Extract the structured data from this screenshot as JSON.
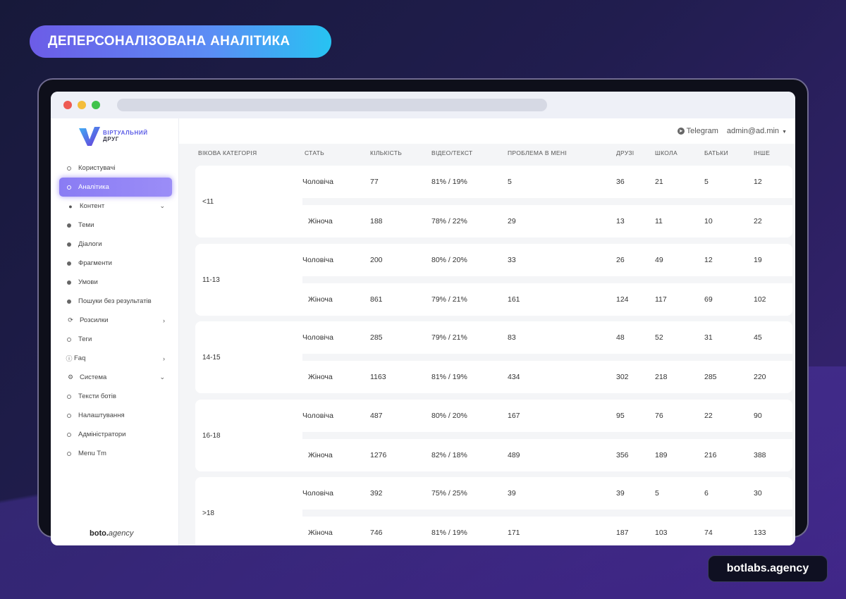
{
  "headline": "ДЕПЕРСОНАЛІЗОВАНА АНАЛІТИКА",
  "brand": "botlabs.agency",
  "logo": {
    "line1": "ВІРТУАЛЬНИЙ",
    "line2": "ДРУГ"
  },
  "topbar": {
    "telegram": "Telegram",
    "admin": "admin@ad.min"
  },
  "sidebar": {
    "items": [
      {
        "label": "Користувачі",
        "icon": "ring"
      },
      {
        "label": "Аналітика",
        "icon": "ring",
        "active": true
      },
      {
        "label": "Контент",
        "icon": "chat-icon",
        "chevron": "down"
      },
      {
        "label": "Теми",
        "icon": "dot"
      },
      {
        "label": "Діалоги",
        "icon": "dot"
      },
      {
        "label": "Фрагменти",
        "icon": "dot"
      },
      {
        "label": "Умови",
        "icon": "dot"
      },
      {
        "label": "Пошуки без результатів",
        "icon": "dot"
      },
      {
        "label": "Розсилки",
        "icon": "broadcast-icon",
        "chevron": "right"
      },
      {
        "label": "Теги",
        "icon": "ring"
      },
      {
        "label": "Faq",
        "icon": "help-icon",
        "chevron": "right"
      },
      {
        "label": "Система",
        "icon": "gears-icon",
        "chevron": "down"
      },
      {
        "label": "Тексти ботів",
        "icon": "ring"
      },
      {
        "label": "Налаштування",
        "icon": "ring"
      },
      {
        "label": "Адміністратори",
        "icon": "ring"
      },
      {
        "label": "Menu Tm",
        "icon": "ring"
      }
    ],
    "footer_bold": "boto.",
    "footer_rest": "agency"
  },
  "table": {
    "headers": [
      "Вікова категорія",
      "Стать",
      "Кількість",
      "Відео/текст",
      "Проблема в мені",
      "Друзі",
      "Школа",
      "Батьки",
      "Інше"
    ],
    "groups": [
      {
        "category": "<11",
        "rows": [
          [
            "Чоловіча",
            "77",
            "81% / 19%",
            "5",
            "36",
            "21",
            "5",
            "12"
          ],
          [
            "Жіноча",
            "188",
            "78% / 22%",
            "29",
            "13",
            "11",
            "10",
            "22"
          ]
        ]
      },
      {
        "category": "11-13",
        "rows": [
          [
            "Чоловіча",
            "200",
            "80% / 20%",
            "33",
            "26",
            "49",
            "12",
            "19"
          ],
          [
            "Жіноча",
            "861",
            "79% / 21%",
            "161",
            "124",
            "117",
            "69",
            "102"
          ]
        ]
      },
      {
        "category": "14-15",
        "rows": [
          [
            "Чоловіча",
            "285",
            "79% / 21%",
            "83",
            "48",
            "52",
            "31",
            "45"
          ],
          [
            "Жіноча",
            "1163",
            "81% / 19%",
            "434",
            "302",
            "218",
            "285",
            "220"
          ]
        ]
      },
      {
        "category": "16-18",
        "rows": [
          [
            "Чоловіча",
            "487",
            "80% / 20%",
            "167",
            "95",
            "76",
            "22",
            "90"
          ],
          [
            "Жіноча",
            "1276",
            "82% / 18%",
            "489",
            "356",
            "189",
            "216",
            "388"
          ]
        ]
      },
      {
        "category": ">18",
        "rows": [
          [
            "Чоловіча",
            "392",
            "75% / 25%",
            "39",
            "39",
            "5",
            "6",
            "30"
          ],
          [
            "Жіноча",
            "746",
            "81% / 19%",
            "171",
            "187",
            "103",
            "74",
            "133"
          ]
        ]
      }
    ]
  }
}
